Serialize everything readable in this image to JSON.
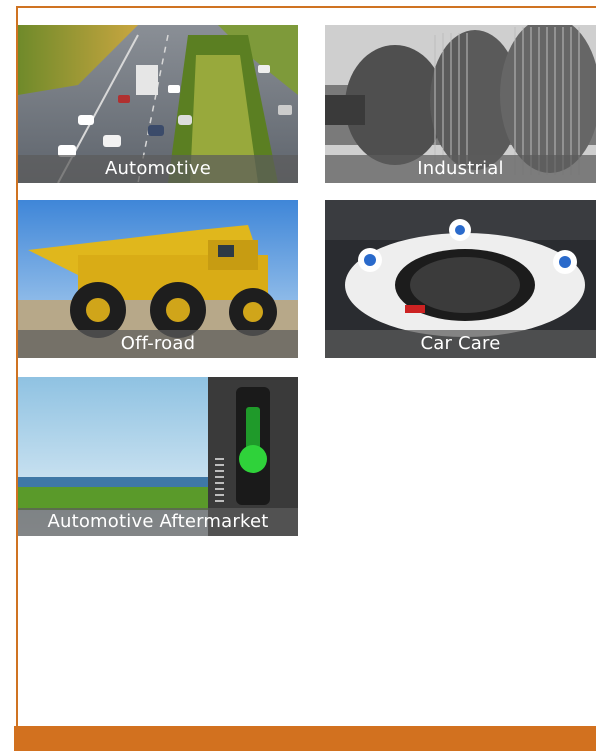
{
  "tiles": [
    {
      "label": "Automotive"
    },
    {
      "label": "Industrial"
    },
    {
      "label": "Off-road"
    },
    {
      "label": "Car Care"
    },
    {
      "label": "Automotive Aftermarket"
    }
  ],
  "colors": {
    "accent": "#d2711f",
    "caption_bg": "#5c5c5c"
  }
}
